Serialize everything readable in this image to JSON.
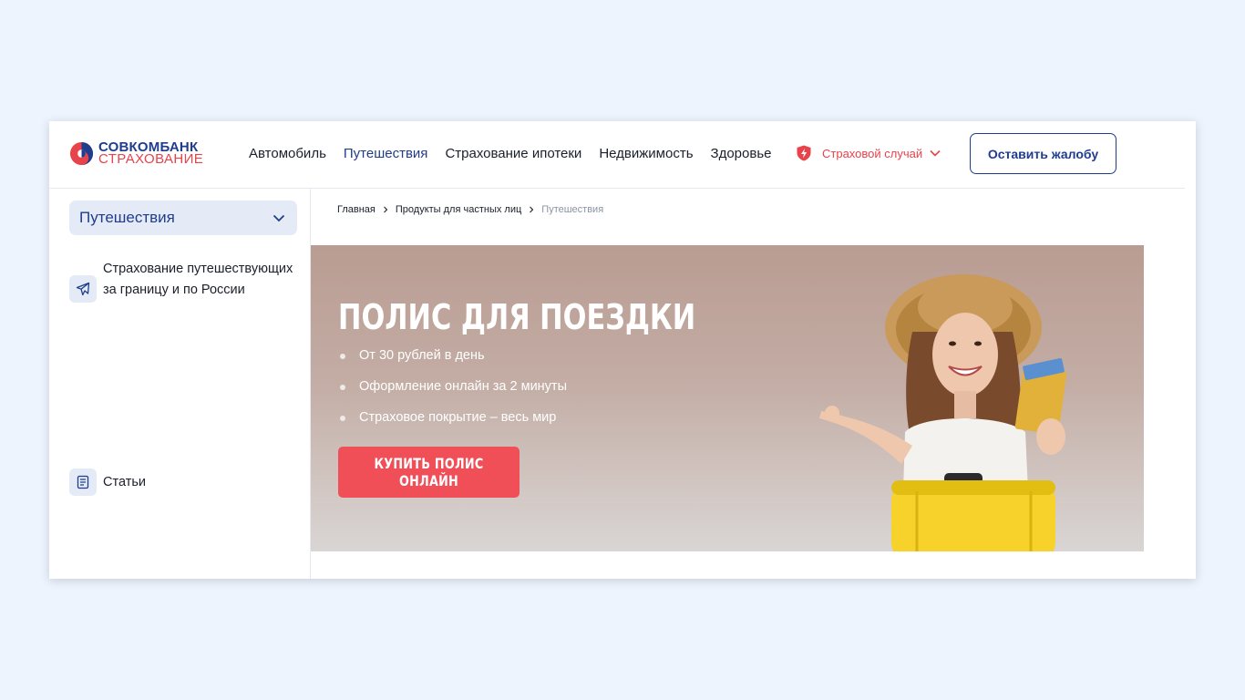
{
  "header": {
    "logo": {
      "line1": "СОВКОМБАНК",
      "line2": "СТРАХОВАНИЕ"
    },
    "nav": [
      {
        "label": "Автомобиль",
        "active": false
      },
      {
        "label": "Путешествия",
        "active": true
      },
      {
        "label": "Страхование ипотеки",
        "active": false
      },
      {
        "label": "Недвижимость",
        "active": false
      },
      {
        "label": "Здоровье",
        "active": false
      }
    ],
    "claim": {
      "label": "Страховой случай",
      "icon": "shield-lightning-icon"
    },
    "complaint_button": "Оставить жалобу"
  },
  "sidebar": {
    "select_label": "Путешествия",
    "items": [
      {
        "label": "Страхование путешествующих за границу и по России",
        "icon": "airplane-icon"
      },
      {
        "label": "Статьи",
        "icon": "document-icon"
      }
    ]
  },
  "breadcrumb": [
    "Главная",
    "Продукты для частных лиц",
    "Путешествия"
  ],
  "hero": {
    "title": "ПОЛИС ДЛЯ ПОЕЗДКИ",
    "bullets": [
      "От 30 рублей в день",
      "Оформление онлайн за 2 минуты",
      "Страховое покрытие – весь мир"
    ],
    "button": "КУПИТЬ ПОЛИС ОНЛАЙН"
  },
  "colors": {
    "brand_blue": "#1f3d8c",
    "brand_red": "#e8424b",
    "button_red": "#f04f58",
    "page_bg": "#eef4fd",
    "sidebar_chip_bg": "#e4ebf6"
  }
}
